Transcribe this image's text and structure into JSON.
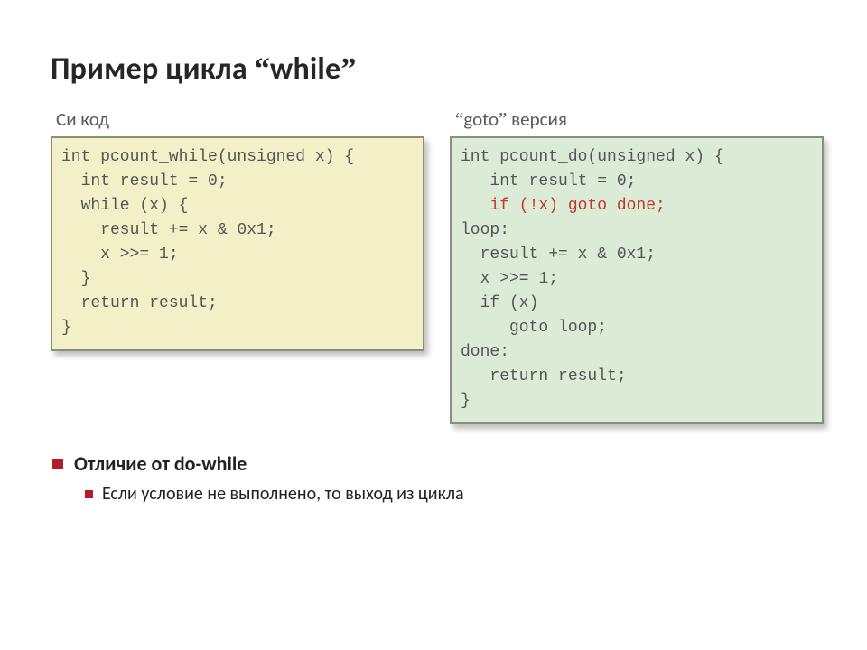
{
  "title_pre": "Пример цикла ",
  "title_kw": "while",
  "left": {
    "heading": "Си код",
    "code": "int pcount_while(unsigned x) {\n  int result = 0;\n  while (x) {\n    result += x & 0x1;\n    x >>= 1;\n  }\n  return result;\n}"
  },
  "right": {
    "heading_kw": "goto",
    "heading_rest": " версия",
    "code_pre": "int pcount_do(unsigned x) {\n   int result = 0;\n   ",
    "code_hl": "if (!x) goto done;",
    "code_post": "\nloop:\n  result += x & 0x1;\n  x >>= 1;\n  if (x)\n     goto loop;\ndone:\n   return result;\n}"
  },
  "bullet1": "Отличие от do-while",
  "bullet2": "Если условие не выполнено, то выход из цикла",
  "glyphs": {
    "lq": "“",
    "rq": "”"
  }
}
